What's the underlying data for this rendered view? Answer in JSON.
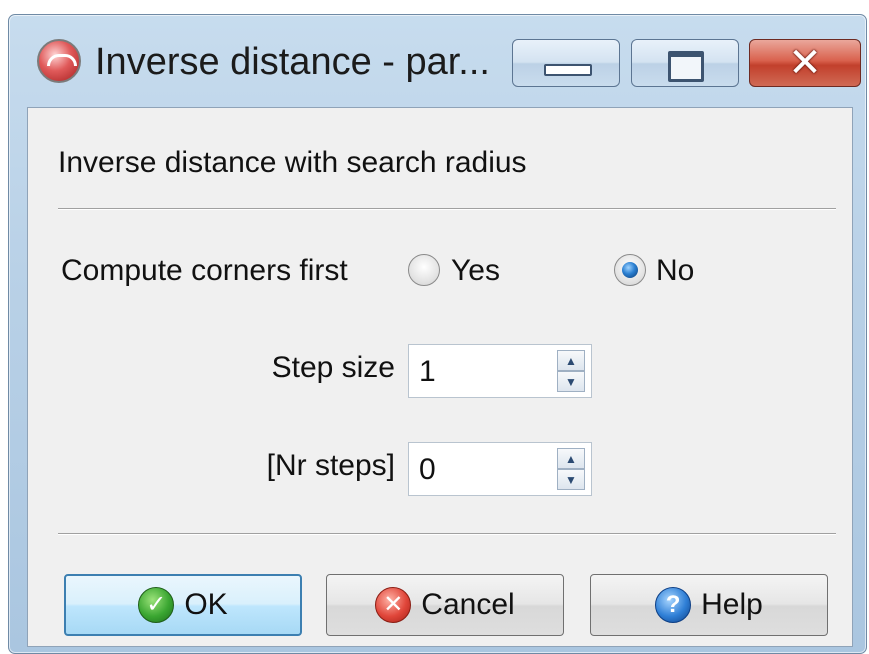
{
  "window": {
    "title": "Inverse distance - par...",
    "controls": {
      "minimize_icon": "minimize-icon",
      "maximize_icon": "maximize-icon",
      "close_icon": "close-icon",
      "close_glyph": "✕"
    }
  },
  "dialog": {
    "subtitle": "Inverse distance with search radius",
    "compute_corners": {
      "label": "Compute corners first",
      "options": [
        {
          "label": "Yes",
          "selected": false
        },
        {
          "label": "No",
          "selected": true
        }
      ]
    },
    "step_size": {
      "label": "Step size",
      "value": "1"
    },
    "nr_steps": {
      "label": "[Nr steps]",
      "value": "0"
    }
  },
  "buttons": {
    "ok": {
      "label": "OK",
      "icon": "check-icon",
      "glyph": "✓"
    },
    "cancel": {
      "label": "Cancel",
      "icon": "cancel-icon",
      "glyph": "✕"
    },
    "help": {
      "label": "Help",
      "icon": "help-icon",
      "glyph": "?"
    }
  },
  "colors": {
    "accent": "#3c7fb1",
    "close_button": "#c2402c"
  }
}
